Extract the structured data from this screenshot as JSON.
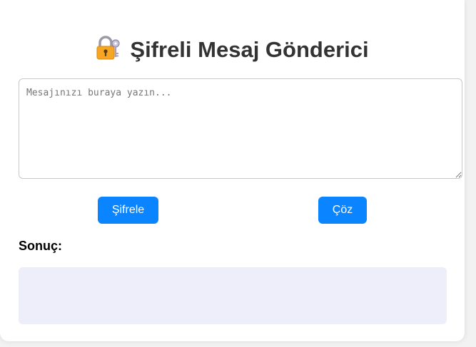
{
  "header": {
    "title": "Şifreli Mesaj Gönderici",
    "icon": "lock-with-key-icon"
  },
  "message": {
    "value": "",
    "placeholder": "Mesajınızı buraya yazın..."
  },
  "actions": {
    "encrypt_label": "Şifrele",
    "decrypt_label": "Çöz"
  },
  "result": {
    "label": "Sonuç:",
    "value": ""
  },
  "colors": {
    "button": "#0b84ff",
    "result_background": "#eeeefa",
    "title_text": "#333333"
  }
}
